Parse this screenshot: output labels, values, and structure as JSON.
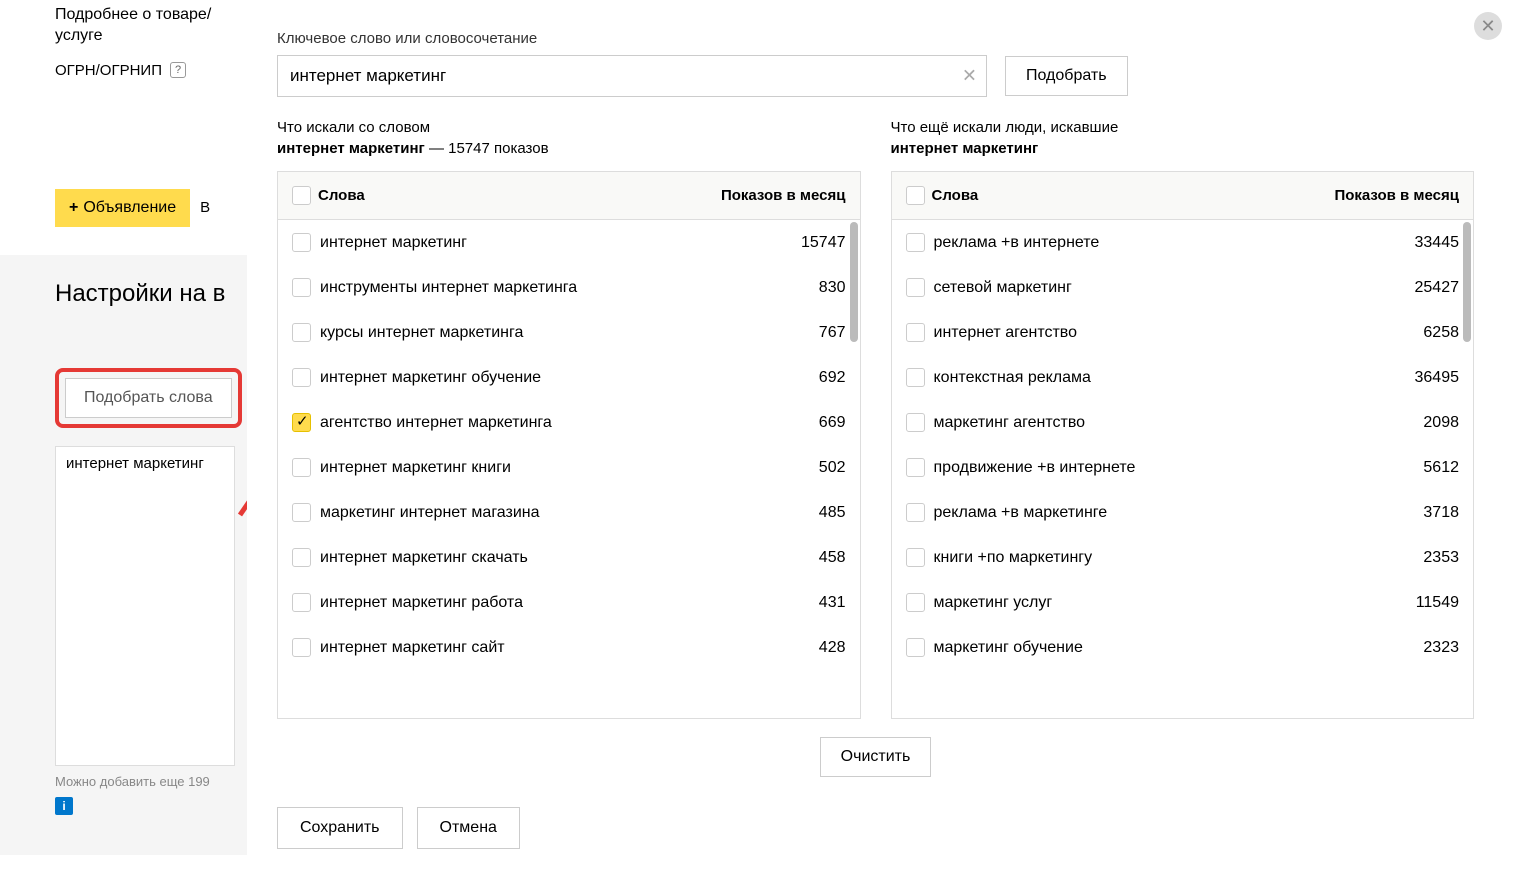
{
  "leftPanel": {
    "item1": "Подробнее о товаре/услуге",
    "item2": "ОГРН/ОГРНИП",
    "addAdButton": "Объявление",
    "btnB": "В",
    "sectionTitle": "Настройки на в",
    "pickWordsButton": "Подобрать слова",
    "keywordValue": "интернет маркетинг",
    "hintText": "Можно добавить еще 199"
  },
  "dialog": {
    "inputLabel": "Ключевое слово или словосочетание",
    "inputValue": "интернет маркетинг",
    "pickButton": "Подобрать",
    "leftCaptionPrefix": "Что искали со словом",
    "leftCaptionBold": "интернет маркетинг",
    "leftCaptionSuffix": " — 15747 показов",
    "rightCaptionPrefix": "Что ещё искали люди, искавшие",
    "rightCaptionBold": "интернет маркетинг",
    "thWords": "Слова",
    "thCount": "Показов в месяц",
    "leftRows": [
      {
        "words": "интернет маркетинг",
        "count": "15747",
        "checked": false
      },
      {
        "words": "инструменты интернет маркетинга",
        "count": "830",
        "checked": false
      },
      {
        "words": "курсы интернет маркетинга",
        "count": "767",
        "checked": false
      },
      {
        "words": "интернет маркетинг обучение",
        "count": "692",
        "checked": false
      },
      {
        "words": "агентство интернет маркетинга",
        "count": "669",
        "checked": true
      },
      {
        "words": "интернет маркетинг книги",
        "count": "502",
        "checked": false
      },
      {
        "words": "маркетинг интернет магазина",
        "count": "485",
        "checked": false
      },
      {
        "words": "интернет маркетинг скачать",
        "count": "458",
        "checked": false
      },
      {
        "words": "интернет маркетинг работа",
        "count": "431",
        "checked": false
      },
      {
        "words": "интернет маркетинг сайт",
        "count": "428",
        "checked": false
      }
    ],
    "rightRows": [
      {
        "words": "реклама +в интернете",
        "count": "33445"
      },
      {
        "words": "сетевой маркетинг",
        "count": "25427"
      },
      {
        "words": "интернет агентство",
        "count": "6258"
      },
      {
        "words": "контекстная реклама",
        "count": "36495"
      },
      {
        "words": "маркетинг агентство",
        "count": "2098"
      },
      {
        "words": "продвижение +в интернете",
        "count": "5612"
      },
      {
        "words": "реклама +в маркетинге",
        "count": "3718"
      },
      {
        "words": "книги +по маркетингу",
        "count": "2353"
      },
      {
        "words": "маркетинг услуг",
        "count": "11549"
      },
      {
        "words": "маркетинг обучение",
        "count": "2323"
      }
    ],
    "clearButton": "Очистить",
    "saveButton": "Сохранить",
    "cancelButton": "Отмена"
  }
}
